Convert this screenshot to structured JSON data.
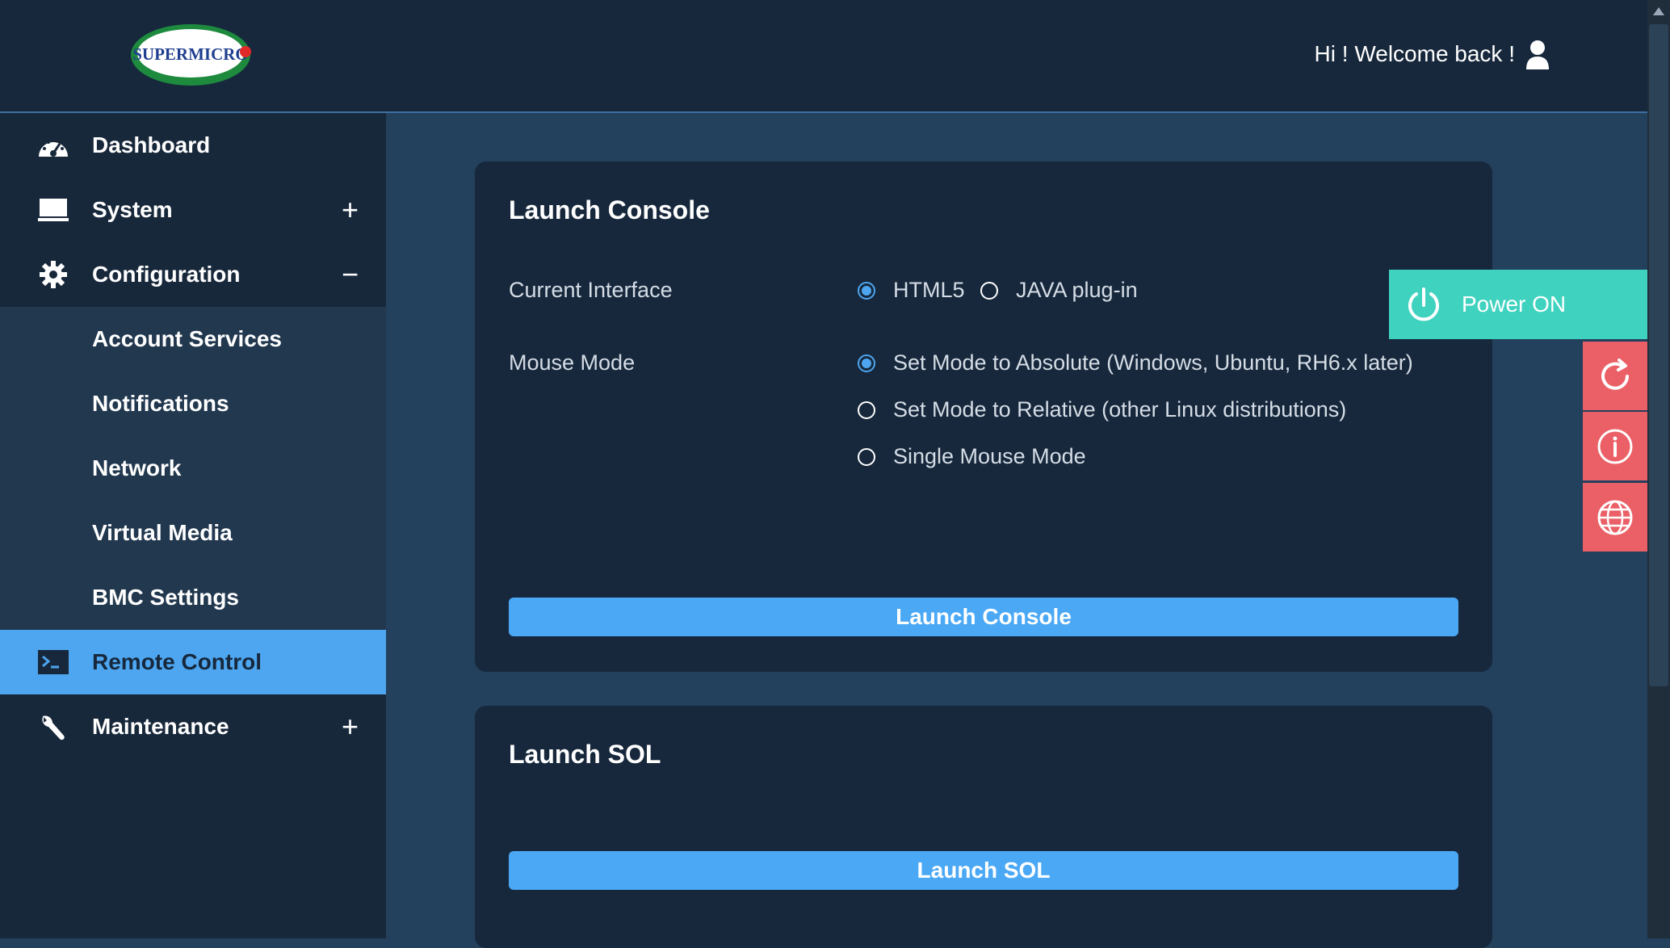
{
  "brand": {
    "logo_text": "SUPERMICRO"
  },
  "header": {
    "welcome": "Hi ! Welcome back !"
  },
  "sidebar": {
    "items": [
      {
        "label": "Dashboard",
        "icon": "dashboard-icon"
      },
      {
        "label": "System",
        "icon": "monitor-icon",
        "toggle": "+"
      },
      {
        "label": "Configuration",
        "icon": "gear-icon",
        "toggle": "−"
      },
      {
        "label": "Account Services"
      },
      {
        "label": "Notifications"
      },
      {
        "label": "Network"
      },
      {
        "label": "Virtual Media"
      },
      {
        "label": "BMC Settings"
      },
      {
        "label": "Remote Control",
        "icon": "terminal-icon",
        "active": true
      },
      {
        "label": "Maintenance",
        "icon": "wrench-icon",
        "toggle": "+"
      }
    ]
  },
  "console_card": {
    "title": "Launch Console",
    "interface_label": "Current Interface",
    "interface_options": [
      {
        "label": "HTML5",
        "selected": true
      },
      {
        "label": "JAVA plug-in",
        "selected": false
      }
    ],
    "mouse_label": "Mouse Mode",
    "mouse_options": [
      {
        "label": "Set Mode to Absolute (Windows, Ubuntu, RH6.x later)",
        "selected": true
      },
      {
        "label": "Set Mode to Relative (other Linux distributions)",
        "selected": false
      },
      {
        "label": "Single Mouse Mode",
        "selected": false
      }
    ],
    "button": "Launch Console"
  },
  "sol_card": {
    "title": "Launch SOL",
    "button": "Launch SOL"
  },
  "power": {
    "label": "Power ON",
    "icon": "power-icon"
  },
  "side_buttons": [
    "refresh-icon",
    "info-icon",
    "globe-icon"
  ],
  "colors": {
    "header_bg": "#17283c",
    "content_bg": "#23405d",
    "accent": "#4da6ef",
    "power": "#3fd2bf",
    "side_buttons": "#ea6066"
  }
}
